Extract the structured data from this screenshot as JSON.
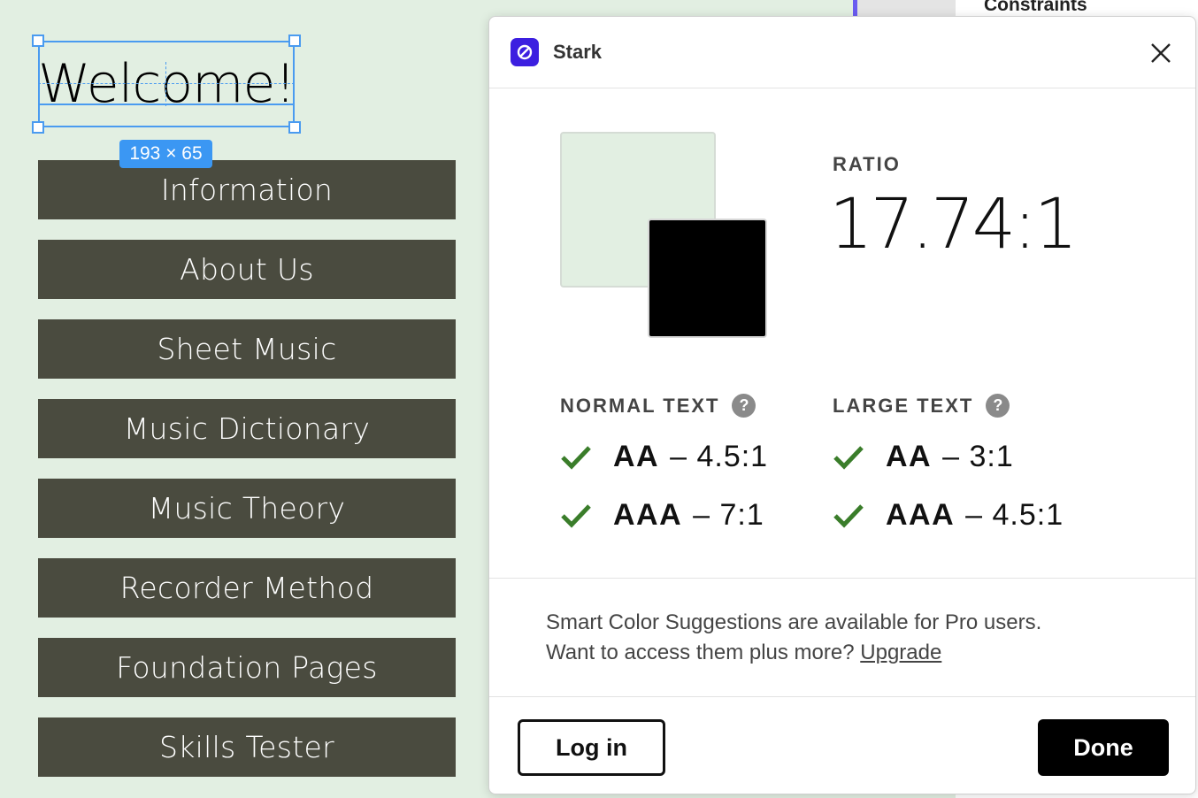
{
  "canvas": {
    "heading": "Welcome!",
    "selection_size": "193 × 65",
    "nav_buttons": [
      "Information",
      "About Us",
      "Sheet Music",
      "Music Dictionary",
      "Music Theory",
      "Recorder Method",
      "Foundation Pages",
      "Skills Tester"
    ],
    "background_color": "#e2efe2",
    "button_color": "#4a4b3f"
  },
  "side_panel": {
    "section_title": "Constraints"
  },
  "dialog": {
    "app_name": "Stark",
    "app_icon": "stark-logo-icon",
    "close_icon": "close-icon",
    "background_swatch_color": "#e2efe2",
    "foreground_swatch_color": "#000000",
    "ratio_label": "RATIO",
    "ratio_value": "17.74:1",
    "normal_text": {
      "heading": "NORMAL TEXT",
      "results": [
        {
          "level": "AA",
          "criterion": "– 4.5:1",
          "pass": true
        },
        {
          "level": "AAA",
          "criterion": "– 7:1",
          "pass": true
        }
      ]
    },
    "large_text": {
      "heading": "LARGE TEXT",
      "results": [
        {
          "level": "AA",
          "criterion": "– 3:1",
          "pass": true
        },
        {
          "level": "AAA",
          "criterion": "– 4.5:1",
          "pass": true
        }
      ]
    },
    "promo_line1": "Smart Color Suggestions are available for Pro users.",
    "promo_line2": "Want to access them plus more?",
    "upgrade_link": "Upgrade",
    "login_label": "Log in",
    "done_label": "Done",
    "pass_color": "#3a7d2a"
  }
}
